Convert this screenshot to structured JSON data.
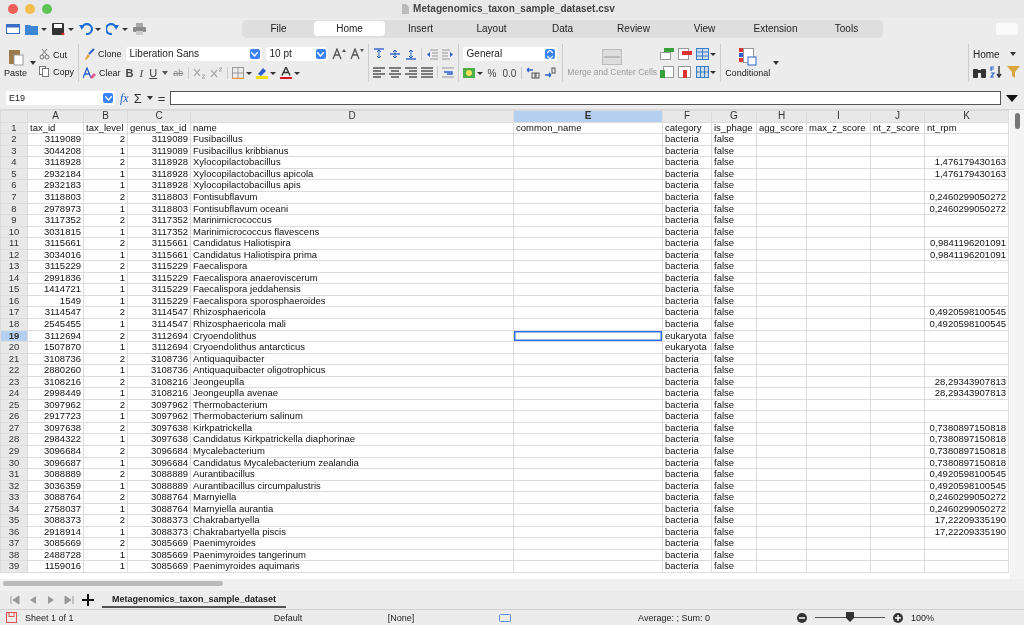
{
  "window": {
    "title": "Metagenomics_taxon_sample_dataset.csv"
  },
  "menu_tabs": [
    {
      "label": "File",
      "selected": false
    },
    {
      "label": "Home",
      "selected": true
    },
    {
      "label": "Insert",
      "selected": false
    },
    {
      "label": "Layout",
      "selected": false
    },
    {
      "label": "Data",
      "selected": false
    },
    {
      "label": "Review",
      "selected": false
    },
    {
      "label": "View",
      "selected": false
    },
    {
      "label": "Extension",
      "selected": false
    },
    {
      "label": "Tools",
      "selected": false
    }
  ],
  "toolbar": {
    "paste": "Paste",
    "cut": "Cut",
    "copy": "Copy",
    "clone": "Clone",
    "clear": "Clear",
    "font_name": "Liberation Sans",
    "font_size": "10 pt",
    "bold": "B",
    "italic": "I",
    "underline": "U",
    "strike": "ab",
    "number_format": "General",
    "percent": "%",
    "decimal": "0.0",
    "merge": "Merge and Center Cells",
    "conditional": "Conditional",
    "sidebar_deck": "Home"
  },
  "formula_bar": {
    "name_box": "E19",
    "fx": "fx",
    "sum": "Σ",
    "equals": "="
  },
  "columns": [
    {
      "letter": "A",
      "kind": "number",
      "selected": false
    },
    {
      "letter": "B",
      "kind": "number",
      "selected": false
    },
    {
      "letter": "C",
      "kind": "number",
      "selected": false
    },
    {
      "letter": "D",
      "kind": "text",
      "selected": false
    },
    {
      "letter": "E",
      "kind": "text",
      "selected": true
    },
    {
      "letter": "F",
      "kind": "text",
      "selected": false
    },
    {
      "letter": "G",
      "kind": "text",
      "selected": false
    },
    {
      "letter": "H",
      "kind": "number",
      "selected": false
    },
    {
      "letter": "I",
      "kind": "number",
      "selected": false
    },
    {
      "letter": "J",
      "kind": "number",
      "selected": false
    },
    {
      "letter": "K",
      "kind": "number",
      "selected": false
    }
  ],
  "rows": [
    {
      "number": "1",
      "kind": "header",
      "selected": false,
      "cells": {
        "A": "tax_id",
        "B": "tax_level",
        "C": "genus_tax_id",
        "D": "name",
        "E": "common_name",
        "F": "category",
        "G": "is_phage",
        "H": "agg_score",
        "I": "max_z_score",
        "J": "nt_z_score",
        "K": "nt_rpm"
      }
    },
    {
      "number": "2",
      "kind": "data",
      "selected": false,
      "cells": {
        "A": "3119089",
        "B": "2",
        "C": "3119089",
        "D": "Fusibacillus",
        "F": "bacteria",
        "G": "false"
      }
    },
    {
      "number": "3",
      "kind": "data",
      "selected": false,
      "cells": {
        "A": "3044208",
        "B": "1",
        "C": "3119089",
        "D": "Fusibacillus kribbianus",
        "F": "bacteria",
        "G": "false"
      }
    },
    {
      "number": "4",
      "kind": "data",
      "selected": false,
      "cells": {
        "A": "3118928",
        "B": "2",
        "C": "3118928",
        "D": "Xylocopilactobacillus",
        "F": "bacteria",
        "G": "false",
        "K": "1,476179430163"
      }
    },
    {
      "number": "5",
      "kind": "data",
      "selected": false,
      "cells": {
        "A": "2932184",
        "B": "1",
        "C": "3118928",
        "D": "Xylocopilactobacillus apicola",
        "F": "bacteria",
        "G": "false",
        "K": "1,476179430163"
      }
    },
    {
      "number": "6",
      "kind": "data",
      "selected": false,
      "cells": {
        "A": "2932183",
        "B": "1",
        "C": "3118928",
        "D": "Xylocopilactobacillus apis",
        "F": "bacteria",
        "G": "false"
      }
    },
    {
      "number": "7",
      "kind": "data",
      "selected": false,
      "cells": {
        "A": "3118803",
        "B": "2",
        "C": "3118803",
        "D": "Fontisubflavum",
        "F": "bacteria",
        "G": "false",
        "K": "0,2460299050272"
      }
    },
    {
      "number": "8",
      "kind": "data",
      "selected": false,
      "cells": {
        "A": "2978973",
        "B": "1",
        "C": "3118803",
        "D": "Fontisubflavum oceani",
        "F": "bacteria",
        "G": "false",
        "K": "0,2460299050272"
      }
    },
    {
      "number": "9",
      "kind": "data",
      "selected": false,
      "cells": {
        "A": "3117352",
        "B": "2",
        "C": "3117352",
        "D": "Marinimicrococcus",
        "F": "bacteria",
        "G": "false"
      }
    },
    {
      "number": "10",
      "kind": "data",
      "selected": false,
      "cells": {
        "A": "3031815",
        "B": "1",
        "C": "3117352",
        "D": "Marinimicrococcus flavescens",
        "F": "bacteria",
        "G": "false"
      }
    },
    {
      "number": "11",
      "kind": "data",
      "selected": false,
      "cells": {
        "A": "3115661",
        "B": "2",
        "C": "3115661",
        "D": "Candidatus Haliotispira",
        "F": "bacteria",
        "G": "false",
        "K": "0,9841196201091"
      }
    },
    {
      "number": "12",
      "kind": "data",
      "selected": false,
      "cells": {
        "A": "3034016",
        "B": "1",
        "C": "3115661",
        "D": "Candidatus Haliotispira prima",
        "F": "bacteria",
        "G": "false",
        "K": "0,9841196201091"
      }
    },
    {
      "number": "13",
      "kind": "data",
      "selected": false,
      "cells": {
        "A": "3115229",
        "B": "2",
        "C": "3115229",
        "D": "Faecalispora",
        "F": "bacteria",
        "G": "false"
      }
    },
    {
      "number": "14",
      "kind": "data",
      "selected": false,
      "cells": {
        "A": "2991836",
        "B": "1",
        "C": "3115229",
        "D": "Faecalispora anaeroviscerum",
        "F": "bacteria",
        "G": "false"
      }
    },
    {
      "number": "15",
      "kind": "data",
      "selected": false,
      "cells": {
        "A": "1414721",
        "B": "1",
        "C": "3115229",
        "D": "Faecalispora jeddahensis",
        "F": "bacteria",
        "G": "false"
      }
    },
    {
      "number": "16",
      "kind": "data",
      "selected": false,
      "cells": {
        "A": "1549",
        "B": "1",
        "C": "3115229",
        "D": "Faecalispora sporosphaeroides",
        "F": "bacteria",
        "G": "false"
      }
    },
    {
      "number": "17",
      "kind": "data",
      "selected": false,
      "cells": {
        "A": "3114547",
        "B": "2",
        "C": "3114547",
        "D": "Rhizosphaericola",
        "F": "bacteria",
        "G": "false",
        "K": "0,4920598100545"
      }
    },
    {
      "number": "18",
      "kind": "data",
      "selected": false,
      "cells": {
        "A": "2545455",
        "B": "1",
        "C": "3114547",
        "D": "Rhizosphaericola mali",
        "F": "bacteria",
        "G": "false",
        "K": "0,4920598100545"
      }
    },
    {
      "number": "19",
      "kind": "data",
      "selected": true,
      "cells": {
        "A": "3112694",
        "B": "2",
        "C": "3112694",
        "D": "Cryoendolithus",
        "F": "eukaryota",
        "G": "false"
      }
    },
    {
      "number": "20",
      "kind": "data",
      "selected": false,
      "cells": {
        "A": "1507870",
        "B": "1",
        "C": "3112694",
        "D": "Cryoendolithus antarcticus",
        "F": "eukaryota",
        "G": "false"
      }
    },
    {
      "number": "21",
      "kind": "data",
      "selected": false,
      "cells": {
        "A": "3108736",
        "B": "2",
        "C": "3108736",
        "D": "Antiquaquibacter",
        "F": "bacteria",
        "G": "false"
      }
    },
    {
      "number": "22",
      "kind": "data",
      "selected": false,
      "cells": {
        "A": "2880260",
        "B": "1",
        "C": "3108736",
        "D": "Antiquaquibacter oligotrophicus",
        "F": "bacteria",
        "G": "false"
      }
    },
    {
      "number": "23",
      "kind": "data",
      "selected": false,
      "cells": {
        "A": "3108216",
        "B": "2",
        "C": "3108216",
        "D": "Jeongeuplla",
        "F": "bacteria",
        "G": "false",
        "K": "28,29343907813"
      }
    },
    {
      "number": "24",
      "kind": "data",
      "selected": false,
      "cells": {
        "A": "2998449",
        "B": "1",
        "C": "3108216",
        "D": "Jeongeuplla avenae",
        "F": "bacteria",
        "G": "false",
        "K": "28,29343907813"
      }
    },
    {
      "number": "25",
      "kind": "data",
      "selected": false,
      "cells": {
        "A": "3097962",
        "B": "2",
        "C": "3097962",
        "D": "Thermobacterium",
        "F": "bacteria",
        "G": "false"
      }
    },
    {
      "number": "26",
      "kind": "data",
      "selected": false,
      "cells": {
        "A": "2917723",
        "B": "1",
        "C": "3097962",
        "D": "Thermobacterium salinum",
        "F": "bacteria",
        "G": "false"
      }
    },
    {
      "number": "27",
      "kind": "data",
      "selected": false,
      "cells": {
        "A": "3097638",
        "B": "2",
        "C": "3097638",
        "D": "Kirkpatrickella",
        "F": "bacteria",
        "G": "false",
        "K": "0,7380897150818"
      }
    },
    {
      "number": "28",
      "kind": "data",
      "selected": false,
      "cells": {
        "A": "2984322",
        "B": "1",
        "C": "3097638",
        "D": "Candidatus Kirkpatrickella diaphorinae",
        "F": "bacteria",
        "G": "false",
        "K": "0,7380897150818"
      }
    },
    {
      "number": "29",
      "kind": "data",
      "selected": false,
      "cells": {
        "A": "3096684",
        "B": "2",
        "C": "3096684",
        "D": "Mycalebacterium",
        "F": "bacteria",
        "G": "false",
        "K": "0,7380897150818"
      }
    },
    {
      "number": "30",
      "kind": "data",
      "selected": false,
      "cells": {
        "A": "3096687",
        "B": "1",
        "C": "3096684",
        "D": "Candidatus Mycalebacterium zealandia",
        "F": "bacteria",
        "G": "false",
        "K": "0,7380897150818"
      }
    },
    {
      "number": "31",
      "kind": "data",
      "selected": false,
      "cells": {
        "A": "3088889",
        "B": "2",
        "C": "3088889",
        "D": "Aurantibacillus",
        "F": "bacteria",
        "G": "false",
        "K": "0,4920598100545"
      }
    },
    {
      "number": "32",
      "kind": "data",
      "selected": false,
      "cells": {
        "A": "3036359",
        "B": "1",
        "C": "3088889",
        "D": "Aurantibacillus circumpalustris",
        "F": "bacteria",
        "G": "false",
        "K": "0,4920598100545"
      }
    },
    {
      "number": "33",
      "kind": "data",
      "selected": false,
      "cells": {
        "A": "3088764",
        "B": "2",
        "C": "3088764",
        "D": "Marnyiella",
        "F": "bacteria",
        "G": "false",
        "K": "0,2460299050272"
      }
    },
    {
      "number": "34",
      "kind": "data",
      "selected": false,
      "cells": {
        "A": "2758037",
        "B": "1",
        "C": "3088764",
        "D": "Marnyiella aurantia",
        "F": "bacteria",
        "G": "false",
        "K": "0,2460299050272"
      }
    },
    {
      "number": "35",
      "kind": "data",
      "selected": false,
      "cells": {
        "A": "3088373",
        "B": "2",
        "C": "3088373",
        "D": "Chakrabartyella",
        "F": "bacteria",
        "G": "false",
        "K": "17,22209335190"
      }
    },
    {
      "number": "36",
      "kind": "data",
      "selected": false,
      "cells": {
        "A": "2918914",
        "B": "1",
        "C": "3088373",
        "D": "Chakrabartyella piscis",
        "F": "bacteria",
        "G": "false",
        "K": "17,22209335190"
      }
    },
    {
      "number": "37",
      "kind": "data",
      "selected": false,
      "cells": {
        "A": "3085669",
        "B": "2",
        "C": "3085669",
        "D": "Paenimyroides",
        "F": "bacteria",
        "G": "false"
      }
    },
    {
      "number": "38",
      "kind": "data",
      "selected": false,
      "cells": {
        "A": "2488728",
        "B": "1",
        "C": "3085669",
        "D": "Paenimyroides tangerinum",
        "F": "bacteria",
        "G": "false"
      }
    },
    {
      "number": "39",
      "kind": "data",
      "selected": false,
      "cells": {
        "A": "1159016",
        "B": "1",
        "C": "3085669",
        "D": "Paenimyroides aquimaris",
        "F": "bacteria",
        "G": "false"
      }
    }
  ],
  "sheet_tabs": [
    {
      "label": "Metagenomics_taxon_sample_dataset",
      "selected": true
    }
  ],
  "status_bar": {
    "sheet": "Sheet 1 of 1",
    "page_style": "Default",
    "language": "[None]",
    "summary": "Average: ; Sum: 0",
    "zoom": {
      "level": 0.5
    },
    "zoom_percent": "100%"
  }
}
